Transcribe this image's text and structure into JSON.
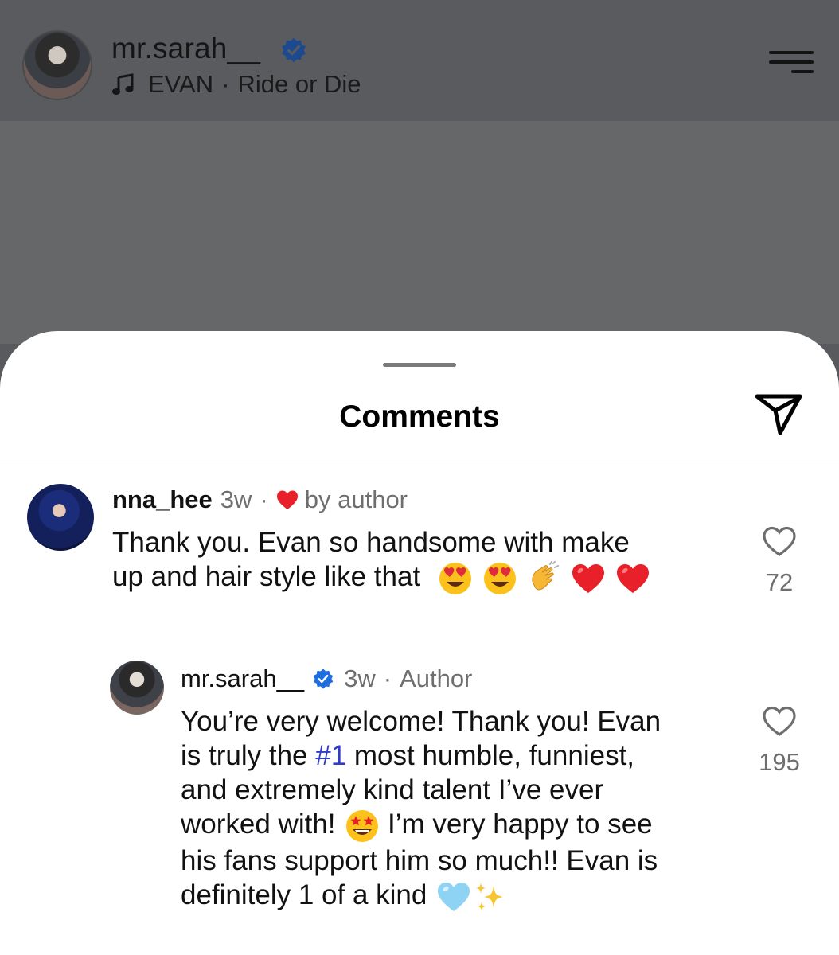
{
  "header": {
    "username": "mr.sarah__",
    "song_artist": "EVAN",
    "song_separator": "·",
    "song_title": "Ride or Die"
  },
  "sheet": {
    "title": "Comments"
  },
  "comments": [
    {
      "username": "nna_hee",
      "time": "3w",
      "separator": "·",
      "badge": "by author",
      "text_line1": "Thank you. Evan so handsome with make",
      "text_line2": "up and hair style like that",
      "emojis": [
        "heart-eyes",
        "heart-eyes",
        "clapping-hands",
        "red-heart",
        "red-heart"
      ],
      "likes": "72"
    },
    {
      "username": "mr.sarah__",
      "time": "3w",
      "separator": "·",
      "badge": "Author",
      "text_part1": "You’re very welcome! Thank you! Evan",
      "text_part2a": "is truly the ",
      "hashtag": "#1",
      "text_part2b": " most humble, funniest,",
      "text_part3": "and extremely kind talent I’ve ever",
      "text_part4a": "worked with! ",
      "text_part4b": " I’m very happy to see",
      "text_part5": "his fans support him so much!! Evan is",
      "text_part6": "definitely 1 of a kind ",
      "emojis": [
        "star-struck",
        "light-blue-heart",
        "sparkles"
      ],
      "likes": "195"
    }
  ],
  "colors": {
    "dim_background": "#585a5d",
    "sheet_background": "#ffffff",
    "verified_blue": "#1d6ee0",
    "heart_red": "#e8202a",
    "hashtag_blue": "#2f3cc8",
    "meta_grey": "#6e6e6e"
  }
}
